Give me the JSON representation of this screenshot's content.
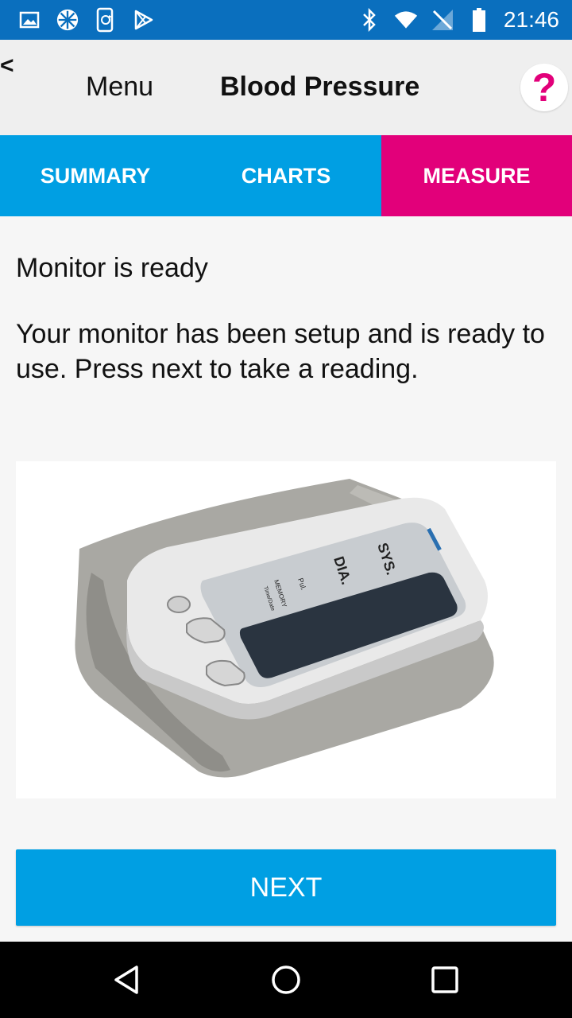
{
  "status_bar": {
    "time": "21:46",
    "left_icons": [
      "gallery-icon",
      "network-app-icon",
      "phone-sync-icon",
      "play-store-icon"
    ],
    "right_icons": [
      "bluetooth-icon",
      "wifi-icon",
      "no-signal-icon",
      "battery-icon"
    ],
    "background_color": "#0a6fbe"
  },
  "app_bar": {
    "back_label": "<",
    "menu_label": "Menu",
    "title": "Blood Pressure",
    "help_label": "?"
  },
  "tabs": [
    {
      "label": "SUMMARY",
      "active": false
    },
    {
      "label": "CHARTS",
      "active": false
    },
    {
      "label": "MEASURE",
      "active": true
    }
  ],
  "colors": {
    "tab_background": "#009fe3",
    "tab_active": "#e2007a",
    "button": "#009fe3",
    "help_accent": "#e2007a"
  },
  "content": {
    "heading": "Monitor is ready",
    "instruction": "Your monitor has been setup and is ready to use. Press next to take a reading.",
    "image_labels": {
      "sys": "SYS.",
      "dia": "DIA.",
      "pul": "Pul.",
      "memory": "MEMORY",
      "time_date": "Time/Date"
    }
  },
  "next_button": {
    "label": "NEXT"
  },
  "nav_bar": {
    "buttons": [
      "back-triangle-icon",
      "home-circle-icon",
      "recents-square-icon"
    ]
  }
}
